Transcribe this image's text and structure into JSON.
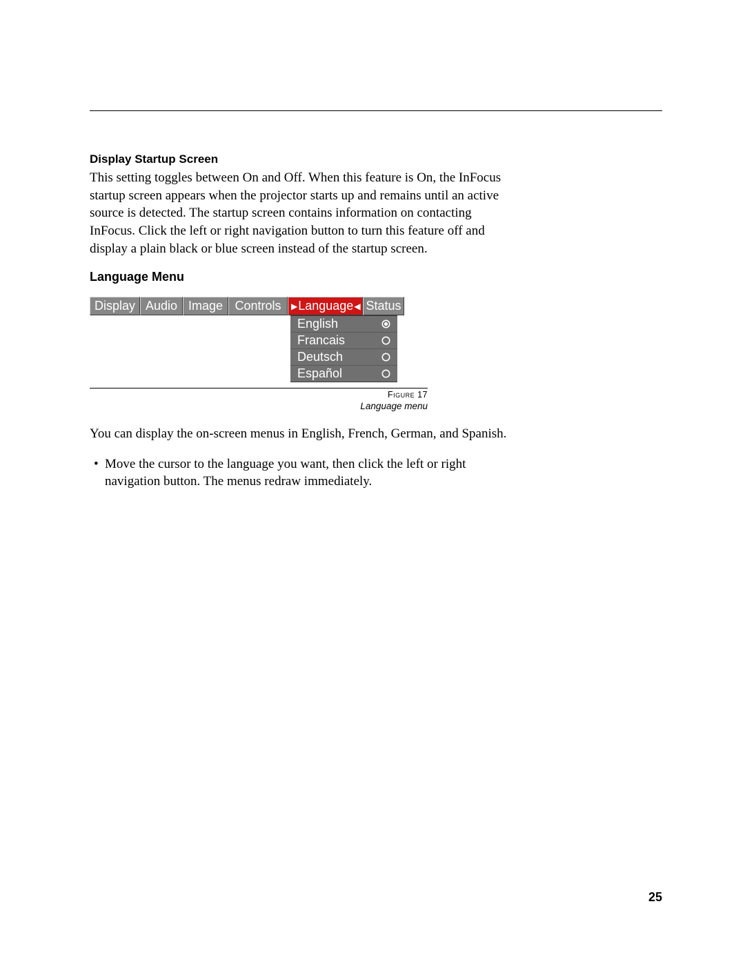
{
  "section1": {
    "heading": "Display Startup Screen",
    "body": "This setting toggles between On and Off. When this feature is On, the InFocus startup screen appears when the projector starts up and remains until an active source is detected. The startup screen contains information on contacting InFocus. Click the left or right navigation button to turn this feature off and display a plain black or blue screen instead of the startup screen."
  },
  "section2": {
    "heading": "Language Menu"
  },
  "menu": {
    "tabs": {
      "display": "Display",
      "audio": "Audio",
      "image": "Image",
      "controls": "Controls",
      "language": "Language",
      "status": "Status"
    },
    "options": [
      {
        "label": "English",
        "selected": true
      },
      {
        "label": "Francais",
        "selected": false
      },
      {
        "label": "Deutsch",
        "selected": false
      },
      {
        "label": "Español",
        "selected": false
      }
    ]
  },
  "figure": {
    "label_word": "Figure",
    "label_num": "17",
    "caption": "Language menu"
  },
  "after_figure": {
    "para": "You can display the on-screen menus in English, French, German, and Spanish.",
    "bullet": "Move the cursor to the language you want, then click the left or right navigation button. The menus redraw immediately."
  },
  "page_number": "25"
}
